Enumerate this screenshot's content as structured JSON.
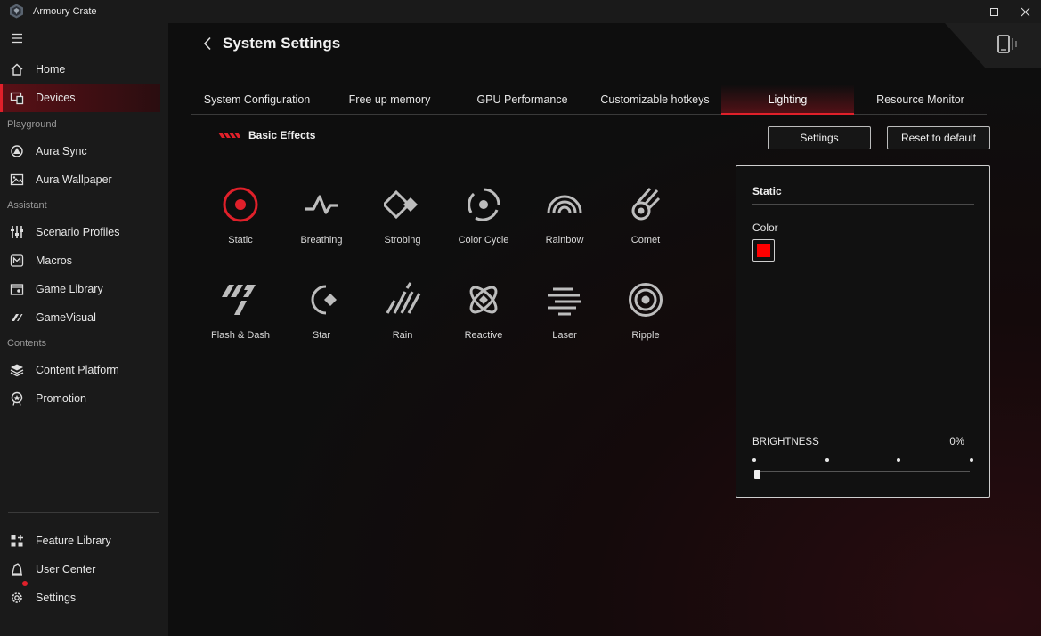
{
  "app": {
    "title": "Armoury Crate"
  },
  "sidebar": {
    "items": [
      {
        "label": "Home",
        "icon": "home-icon"
      },
      {
        "label": "Devices",
        "icon": "devices-icon",
        "active": true
      },
      {
        "label": "Aura Sync",
        "icon": "aura-sync-icon"
      },
      {
        "label": "Aura Wallpaper",
        "icon": "wallpaper-icon"
      },
      {
        "label": "Scenario Profiles",
        "icon": "scenario-profiles-icon"
      },
      {
        "label": "Macros",
        "icon": "macros-icon"
      },
      {
        "label": "Game Library",
        "icon": "game-library-icon"
      },
      {
        "label": "GameVisual",
        "icon": "gamevisual-icon"
      },
      {
        "label": "Content Platform",
        "icon": "content-platform-icon"
      },
      {
        "label": "Promotion",
        "icon": "promotion-icon"
      },
      {
        "label": "Feature Library",
        "icon": "feature-library-icon"
      },
      {
        "label": "User Center",
        "icon": "user-center-icon"
      },
      {
        "label": "Settings",
        "icon": "settings-gear-icon",
        "badge": true
      }
    ],
    "sections": [
      "Playground",
      "Assistant",
      "Contents"
    ]
  },
  "header": {
    "title": "System Settings"
  },
  "tabs": [
    {
      "label": "System Configuration"
    },
    {
      "label": "Free up memory"
    },
    {
      "label": "GPU Performance"
    },
    {
      "label": "Customizable hotkeys"
    },
    {
      "label": "Lighting",
      "active": true
    },
    {
      "label": "Resource Monitor"
    }
  ],
  "effects": {
    "title": "Basic Effects",
    "settings_button": "Settings",
    "reset_button": "Reset to default",
    "items": [
      {
        "label": "Static",
        "icon": "static-icon",
        "selected": true
      },
      {
        "label": "Breathing",
        "icon": "breathing-icon"
      },
      {
        "label": "Strobing",
        "icon": "strobing-icon"
      },
      {
        "label": "Color Cycle",
        "icon": "color-cycle-icon"
      },
      {
        "label": "Rainbow",
        "icon": "rainbow-icon"
      },
      {
        "label": "Comet",
        "icon": "comet-icon"
      },
      {
        "label": "Flash & Dash",
        "icon": "flash-dash-icon"
      },
      {
        "label": "Star",
        "icon": "star-icon"
      },
      {
        "label": "Rain",
        "icon": "rain-icon"
      },
      {
        "label": "Reactive",
        "icon": "reactive-icon"
      },
      {
        "label": "Laser",
        "icon": "laser-icon"
      },
      {
        "label": "Ripple",
        "icon": "ripple-icon"
      }
    ]
  },
  "panel": {
    "title": "Static",
    "color_label": "Color",
    "color_value": "#ff0000",
    "brightness_label": "BRIGHTNESS",
    "brightness_value": "0%"
  },
  "colors": {
    "accent": "#e0202a",
    "selected_color": "#ff0000"
  }
}
